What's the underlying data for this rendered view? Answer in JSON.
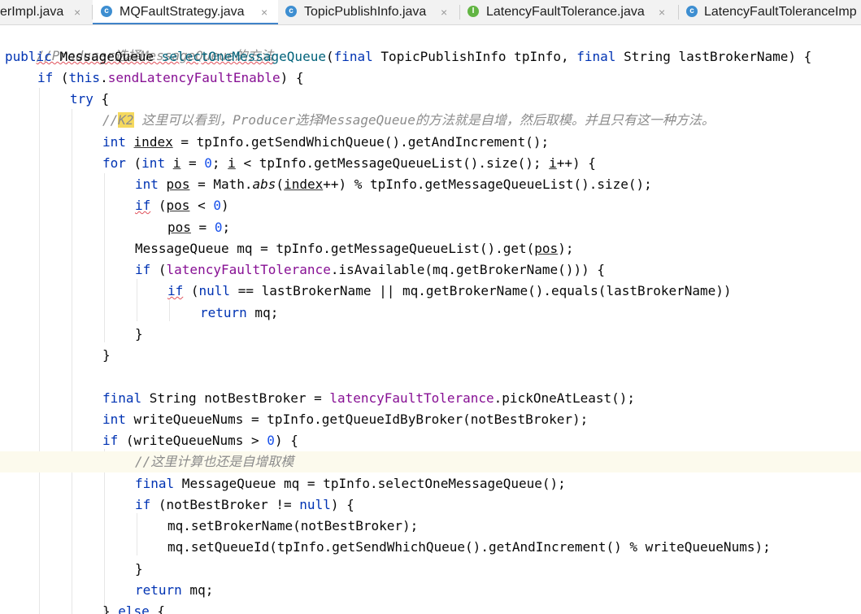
{
  "tabs": [
    {
      "name": "erImpl.java",
      "icon": "class-icon",
      "active": false
    },
    {
      "name": "MQFaultStrategy.java",
      "icon": "class-icon",
      "active": true
    },
    {
      "name": "TopicPublishInfo.java",
      "icon": "class-icon",
      "active": false
    },
    {
      "name": "LatencyFaultTolerance.java",
      "icon": "interface-icon",
      "active": false
    },
    {
      "name": "LatencyFaultToleranceImp",
      "icon": "class-icon",
      "active": false
    }
  ],
  "close_glyph": "×",
  "icon_letters": {
    "class": "c",
    "interface": "I"
  },
  "code": {
    "l1": {
      "comment": "//Producer选择MessageQueue的方法"
    },
    "l2": {
      "kw_public": "public",
      "type": "MessageQueue",
      "method": "selectOneMessageQueue",
      "open": "(",
      "kw_final": "final",
      "param1": "TopicPublishInfo tpInfo, ",
      "kw_final2": "final",
      "param2": "String lastBrokerName) {"
    },
    "l3": {
      "kw_if": "if",
      "open": " (",
      "kw_this": "this",
      "dot": ".",
      "field": "sendLatencyFaultEnable",
      "close": ") {"
    },
    "l4": {
      "kw_try": "try",
      "brace": " {"
    },
    "l5": {
      "slashes": "//",
      "tag": "K2",
      "text": " 这里可以看到，Producer选择MessageQueue的方法就是自增，然后取模。并且只有这一种方法。"
    },
    "l6": {
      "kw_int": "int",
      "var": "index",
      "rest": " = tpInfo.getSendWhichQueue().getAndIncrement();"
    },
    "l7": {
      "kw_for": "for",
      "p1": " (",
      "kw_int": "int",
      "sp": " ",
      "var_i": "i",
      "eq": " = ",
      "zero": "0",
      "semi": "; ",
      "var_i2": "i",
      "cond": " < tpInfo.getMessageQueueList().size(); ",
      "var_i3": "i",
      "end": "++) {"
    },
    "l8": {
      "kw_int": "int",
      "var": "pos",
      "eq": " = Math.",
      "abs": "abs",
      "p": "(",
      "index": "index",
      "rest": "++) % tpInfo.getMessageQueueList().size();"
    },
    "l9": {
      "kw_if": "if",
      "p": " (",
      "var": "pos",
      "lt": " < ",
      "zero": "0",
      "close": ")"
    },
    "l10": {
      "var": "pos",
      "eq": " = ",
      "zero": "0",
      "semi": ";"
    },
    "l11": {
      "text": "MessageQueue mq = tpInfo.getMessageQueueList().get(",
      "var": "pos",
      "close": ");"
    },
    "l12": {
      "kw_if": "if",
      "p": " (",
      "field": "latencyFaultTolerance",
      "rest": ".isAvailable(mq.getBrokerName())) {"
    },
    "l13": {
      "kw_if": "if",
      "p": " (",
      "kw_null": "null",
      "rest": " == lastBrokerName || mq.getBrokerName().equals(lastBrokerName))"
    },
    "l14": {
      "kw_return": "return",
      "rest": " mq;"
    },
    "l15": {
      "brace": "}"
    },
    "l16": {
      "brace": "}"
    },
    "l18": {
      "kw_final": "final",
      "mid": " String notBestBroker = ",
      "field": "latencyFaultTolerance",
      "rest": ".pickOneAtLeast();"
    },
    "l19": {
      "kw_int": "int",
      "rest": " writeQueueNums = tpInfo.getQueueIdByBroker(notBestBroker);"
    },
    "l20": {
      "kw_if": "if",
      "p": " (writeQueueNums > ",
      "zero": "0",
      "close": ") {"
    },
    "l21": {
      "comment": "//这里计算也还是自增取模"
    },
    "l22": {
      "kw_final": "final",
      "rest": " MessageQueue mq = tpInfo.selectOneMessageQueue();"
    },
    "l23": {
      "kw_if": "if",
      "p": " (notBestBroker != ",
      "kw_null": "null",
      "close": ") {"
    },
    "l24": {
      "text": "mq.setBrokerName(notBestBroker);"
    },
    "l25": {
      "text": "mq.setQueueId(tpInfo.getSendWhichQueue().getAndIncrement() % writeQueueNums);"
    },
    "l26": {
      "brace": "}"
    },
    "l27": {
      "kw_return": "return",
      "rest": " mq;"
    },
    "l28": {
      "brace": "} ",
      "kw_else": "else",
      "rest": " {"
    }
  }
}
